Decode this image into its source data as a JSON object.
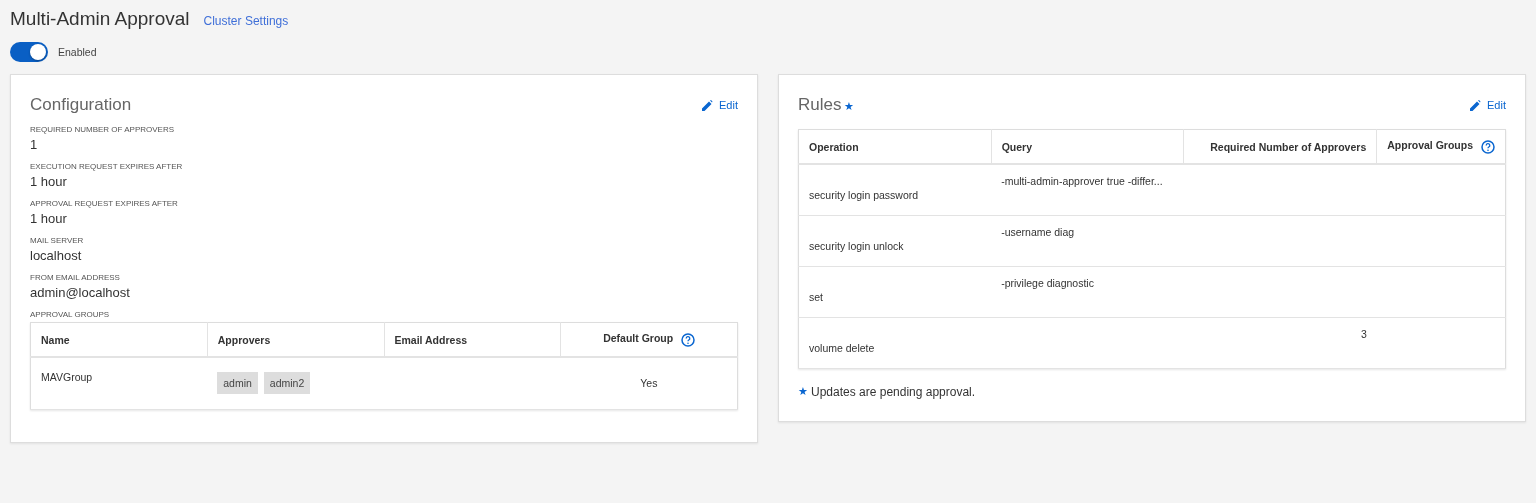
{
  "header": {
    "title": "Multi-Admin Approval",
    "link": "Cluster Settings"
  },
  "toggle": {
    "on": true,
    "label": "Enabled"
  },
  "configuration": {
    "title": "Configuration",
    "edit": "Edit",
    "fields": [
      {
        "label": "REQUIRED NUMBER OF APPROVERS",
        "value": "1"
      },
      {
        "label": "EXECUTION REQUEST EXPIRES AFTER",
        "value": "1 hour"
      },
      {
        "label": "APPROVAL REQUEST EXPIRES AFTER",
        "value": "1 hour"
      },
      {
        "label": "MAIL SERVER",
        "value": "localhost"
      },
      {
        "label": "FROM EMAIL ADDRESS",
        "value": "admin@localhost"
      }
    ],
    "groups_label": "APPROVAL GROUPS",
    "groups_table": {
      "columns": [
        "Name",
        "Approvers",
        "Email Address",
        "Default Group"
      ],
      "rows": [
        {
          "name": "MAVGroup",
          "approvers": [
            "admin",
            "admin2"
          ],
          "default_group": "Yes"
        }
      ]
    }
  },
  "rules": {
    "title": "Rules",
    "pending_mark": "★",
    "edit": "Edit",
    "table": {
      "columns": [
        "Operation",
        "Query",
        "Required Number of Approvers",
        "Approval Groups"
      ],
      "rows": [
        {
          "operation": "security login password",
          "query": "-multi-admin-approver true -differ..."
        },
        {
          "operation": "security login unlock",
          "query": "-username diag"
        },
        {
          "operation": "set",
          "query": "-privilege diagnostic"
        },
        {
          "operation": "volume delete",
          "required_approvers": "3"
        }
      ]
    },
    "note_mark": "★",
    "note": "Updates are pending approval."
  }
}
